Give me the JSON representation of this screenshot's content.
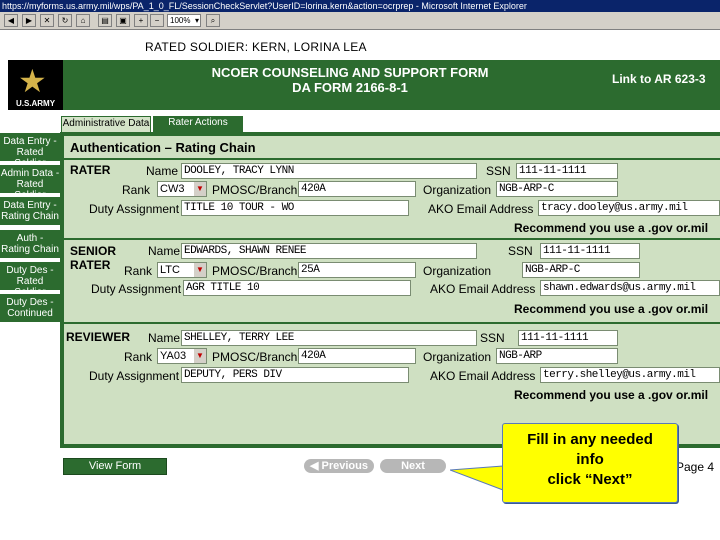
{
  "browser": {
    "title_bar": "https://myforms.us.army.mil/wps/PA_1_0_FL/SessionCheckServlet?UserID=lorina.kern&action=ocrprep - Microsoft Internet Explorer",
    "zoom": "100%"
  },
  "rated_soldier": "RATED SOLDIER: KERN, LORINA LEA",
  "header": {
    "logo_text": "U.S.ARMY",
    "title_line1": "NCOER COUNSELING AND SUPPORT FORM",
    "title_line2": "DA FORM 2166-8-1",
    "link": "Link to AR 623-3"
  },
  "nav": [
    {
      "line1": "Data Entry -",
      "line2": "Rated Soldier"
    },
    {
      "line1": "Admin Data -",
      "line2": "Rated Soldier"
    },
    {
      "line1": "Data Entry -",
      "line2": "Rating Chain"
    },
    {
      "line1": "Auth -",
      "line2": "Rating Chain"
    },
    {
      "line1": "Duty Des -",
      "line2": "Rated Soldier"
    },
    {
      "line1": "Duty Des -",
      "line2": "Continued"
    }
  ],
  "tabs": {
    "active": "Administrative Data",
    "inactive": "Rater Actions"
  },
  "section_title": "Authentication – Rating Chain",
  "labels": {
    "name": "Name",
    "ssn": "SSN",
    "rank": "Rank",
    "pmosc": "PMOSC/Branch",
    "organization": "Organization",
    "duty_assignment": "Duty Assignment",
    "ako_email": "AKO Email Address",
    "recommend": "Recommend you use a .gov or.mil"
  },
  "rater": {
    "section": "RATER",
    "name": "DOOLEY, TRACY LYNN",
    "ssn": "111-11-1111",
    "rank": "CW3",
    "pmosc": "420A",
    "organization": "NGB-ARP-C",
    "duty": "TITLE 10 TOUR - WO",
    "email": "tracy.dooley@us.army.mil"
  },
  "senior_rater": {
    "section_line1": "SENIOR",
    "section_line2": "RATER",
    "name": "EDWARDS, SHAWN RENEE",
    "ssn": "111-11-1111",
    "rank": "LTC",
    "pmosc": "25A",
    "organization": "NGB-ARP-C",
    "duty": "AGR TITLE 10",
    "email": "shawn.edwards@us.army.mil"
  },
  "reviewer": {
    "section": "REVIEWER",
    "name": "SHELLEY, TERRY LEE",
    "ssn": "111-11-1111",
    "rank": "YA03",
    "pmosc": "420A",
    "organization": "NGB-ARP",
    "duty": "DEPUTY, PERS DIV",
    "email": "terry.shelley@us.army.mil"
  },
  "buttons": {
    "view_form": "View Form",
    "previous": "Previous",
    "next": "Next"
  },
  "page_label": "Page 4",
  "callout": {
    "line1": "Fill in any needed",
    "line2": "info",
    "line3": "click “Next”"
  }
}
